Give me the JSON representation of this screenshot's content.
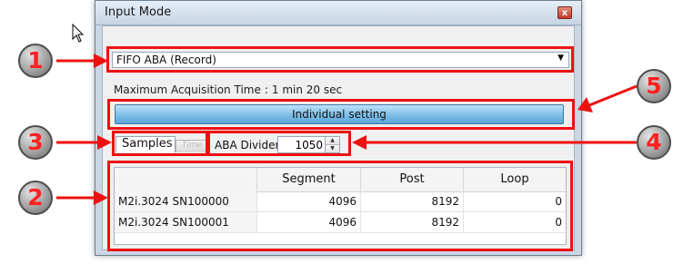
{
  "window": {
    "title": "Input Mode",
    "close_glyph": "x"
  },
  "mode_select": {
    "value": "FIFO ABA (Record)",
    "arrow_glyph": "▼"
  },
  "max_acquisition": {
    "label": "Maximum Acquisition Time",
    "separator": ":",
    "value": "1 min 20 sec"
  },
  "individual_setting_label": "Individual setting",
  "tabs": [
    {
      "label": "Samples"
    },
    {
      "label": "Time"
    }
  ],
  "aba_divider": {
    "label": "ABA Divider",
    "value": "1050"
  },
  "table": {
    "columns": [
      "",
      "Segment",
      "Post",
      "Loop"
    ],
    "rows": [
      {
        "name": "M2i.3024 SN100000",
        "segment": "4096",
        "post": "8192",
        "loop": "0"
      },
      {
        "name": "M2i.3024 SN100001",
        "segment": "4096",
        "post": "8192",
        "loop": "0"
      }
    ]
  },
  "annotations": {
    "color": "#ee1111",
    "badges": [
      "1",
      "2",
      "3",
      "4",
      "5"
    ]
  }
}
